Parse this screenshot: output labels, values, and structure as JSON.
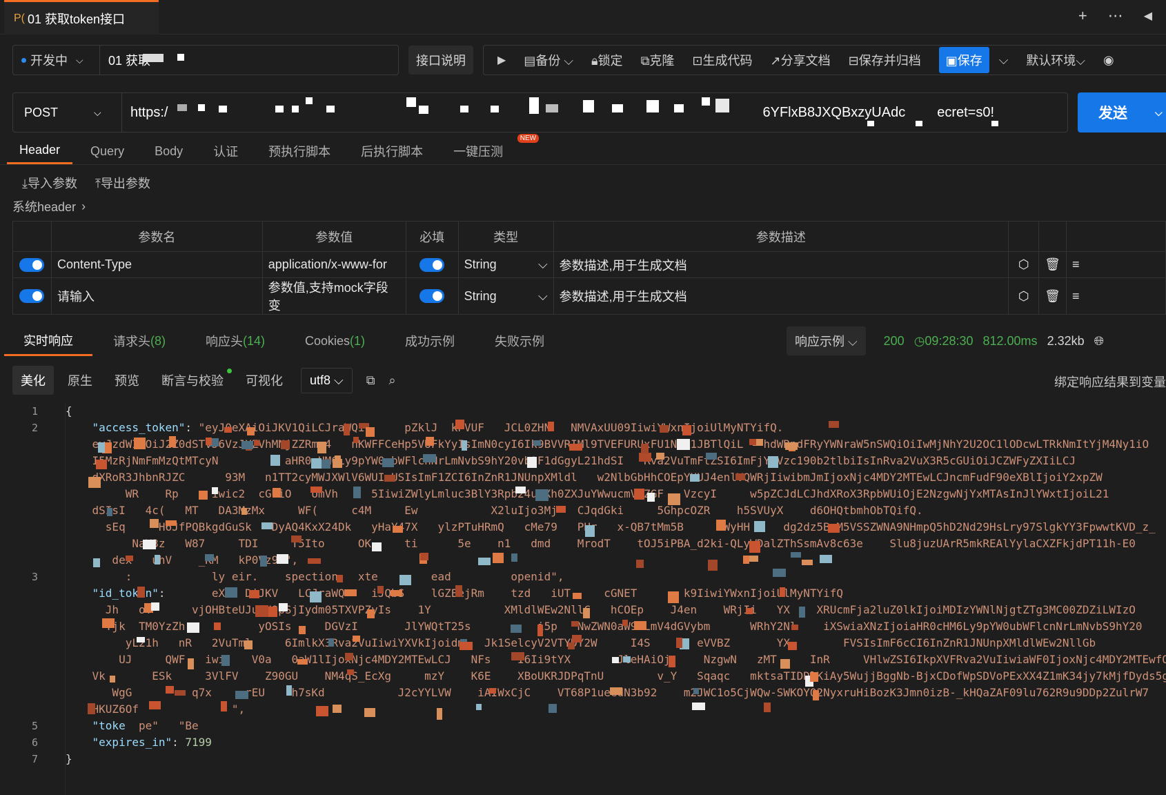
{
  "tab": {
    "method": "P(",
    "title": "01 获取token接口"
  },
  "env": {
    "label": "开发中"
  },
  "request_name": "01 获取",
  "toolbar": {
    "doc": "接口说明",
    "backup": "备份",
    "lock": "锁定",
    "clone": "克隆",
    "gen_code": "生成代码",
    "share_doc": "分享文档",
    "save_archive": "保存并归档",
    "save": "保存",
    "default_env": "默认环境"
  },
  "url": {
    "method": "POST",
    "prefix": "https:/",
    "middle": "6YFlxB8JXQBxzyUAdc",
    "suffix": "ecret=s0!",
    "send": "发送"
  },
  "subtabs": [
    "Header",
    "Query",
    "Body",
    "认证",
    "预执行脚本",
    "后执行脚本",
    "一键压测"
  ],
  "new_badge": "NEW",
  "import_params": "导入参数",
  "export_params": "导出参数",
  "system_header": "系统header",
  "table": {
    "headers": [
      "参数名",
      "参数值",
      "必填",
      "类型",
      "参数描述"
    ],
    "rows": [
      {
        "name": "Content-Type",
        "value": "application/x-www-for",
        "type": "String",
        "desc_placeholder": "参数描述,用于生成文档"
      },
      {
        "name_placeholder": "请输入",
        "value_placeholder": "参数值,支持mock字段变",
        "type": "String",
        "desc_placeholder": "参数描述,用于生成文档"
      }
    ]
  },
  "response_tabs": {
    "realtime": "实时响应",
    "req_headers": "请求头",
    "req_headers_count": "(8)",
    "resp_headers": "响应头",
    "resp_headers_count": "(14)",
    "cookies": "Cookies",
    "cookies_count": "(1)",
    "success_example": "成功示例",
    "fail_example": "失败示例"
  },
  "response_status": {
    "example_select": "响应示例",
    "code": "200",
    "time": "09:28:30",
    "duration": "812.00ms",
    "size": "2.32kb"
  },
  "view_modes": [
    "美化",
    "原生",
    "预览",
    "断言与校验",
    "可视化"
  ],
  "encoding": "utf8",
  "bind_var": "绑定响应结果到变量",
  "colors": {
    "accent": "#f26d21",
    "primary": "#1677e8",
    "success": "#4caf50"
  },
  "code_lines": {
    "l1": "{",
    "l2_key": "\"access_token\"",
    "l2_val": "\"eyJ0eXAiOiJKV1QiLCJraWQi      pZklJ  kPVUF   JCL0ZHN   NMVAxUU09IiwiYWxnIjoiUlMyNTYifQ.",
    "l2b": "eyJzdWIiOiJ2Z0dSTVJ6VzJXZVhMNjZZRmx4   nKWFFCeHp5VUFkYyIsImN0cyI6Ik9BVVRIMl9TVEFURUxFU1NfR1JBTlQiL   hdWRpdFRyYWNraW5nSWQiOiIwMjNhY2U2OC1lODcwLTRkNmItYjM4Ny1iO",
    "l2c": "I5MzRjNmFmMzQtMTcyN          aHR0cHM6Ly9pYW0ubWFlcnNrLmNvbS9hY20vb2F1dGgyL21hdSI   Rva2VuTmFtZSI6ImFjY2Vzc190b2tlbiIsInRva2VuX3R5cGUiOiJCZWFyZXIiLCJ",
    "l2d": "dXRoR3JhbnRJZC      93M   n1TT2cyMWJXWlV6WUIxUSIsImF1ZCI6InZnR1JNUnpXMldl   w2NlbGbHhCOEpYUUJ4enlVQWRjIiwibmJmIjoxNjc4MDY2MTEwLCJncmFudF90eXBlIjoiY2xpZW",
    "l2e": "     WR    Rp     iwic2  cGUiO   UmVh     5IiwiZWlyLmluc3BlY3Rpb24uZXh0ZXJuYWwucmVhZGF   VzcyI     w5pZCJdLCJhdXRoX3RpbWUiOjE2NzgwNjYxMTAsInJlYWxtIjoiL21",
    "l2f": "dSIsI   4c(   MT   DA3MzMx     WF(     c4M     Ew           X2luIjo3Mj   CJqdGki     5GhpcOZR    h5SVUyX    d6OHQtbmhObTQifQ.",
    "l2g": "  sEq     H6JfPQBkgdGuSk   DyAQ4KxX24Dk   yHaY47X   ylzPTuHRmQ   cMe79   PHr   x-QB7tMm5B     OWyHH     dg2dz5BwM5VSSZWNA9NHmpQ5hD2Nd29HsLry97SlgkYY3FpwwtKVD_z_",
    "l2h": "      NaV3z   W87     TDI     T5Ito     OK     ti      5e    n1   dmd    MrodT    tOJ5iPBA_d2ki-QLyWDalZThSsmAv8c63e    Slu8juzUArR5mkREAlYylaCXZFkjdPT11h-E0",
    "l2i": "   dex   uhV    _KM   kP0Vz9A\",",
    "l3": "     :            ly eir.    spection   xte        ead         openid\",",
    "l4_key": "\"id_token\"",
    "l4_val": "      eX   DiJKV   LCJraWQ    iJQbS    lGZEejRm    tzd   iUT     cGNET       k9IiwiYWxnIjoiUlMyNTYifQ",
    "l4b": "  Jh   oY      vjOHBteUJuLU9pSjIydm05TXVPZyIs    1Y           XMldlWEw2NllC   hCOEp    J4en    WRjIi   YX    XRUcmFja2luZ0lkIjoiMDIzYWNlNjgtZTg3MC00ZDZiLWIzO",
    "l4c": "  Yjk  TM0YzZh           yOSIs     DGVzI       JlYWQtT25s          i5p   NwZWN0aW9uLmV4dGVybm      WRhY2Nl    iXSwiaXNzIjoiaHR0cHM6Ly9pYW0ubWFlcnNrLmNvbS9hY20",
    "l4d": "     yL21h   nR   2VuTml     6ImlkX3Rva2VuIiwiYXVkIjoidm   Jk1SelcyV2VTYDY2W     I4S       eVVBZ       YX        FVSIsImF6cCI6InZnR1JNUnpXMldlWEw2NllGb",
    "l4e": "    UJ     QWF   iwi    V0a   0aW1lIjoxNjc4MDY2MTEwLCJ   NFs    I6Ii9tYX       JleHAiOj     NzgwN   zMT     InR     VHlwZSI6IkpXVFRva2VuIiwiaWF0IjoxNjc4MDY2MTEwfQ.",
    "l4f": "Vk       ESk     3VlFV    Z90GU    NM4qS_EcXg     mzY    K6E    XBoUKRJDPqTnU        v_Y   Sqaqc   mktsaTIDDlKiAy5WujjBggNb-BjxCDofWpSDVoPExXX4Z1mK34jy7kMjfDyds5g",
    "l4g": "   WgG         q7x     rEU    h7sKd           J2cYYLVW    iAIWxCjC    VT68P1ueedN3b92    m2JWC1o5CjWQw-SWKOYO2NyxruHiBozK3Jmn0izB-_kHQaZAF09lu762R9u9DDp2ZulrW7",
    "l4h": "HKUZ6Of              \",",
    "l5_key": "\"toke",
    "l5_rest": "  pe\"   \"Be",
    "l6_key": "\"expires_in\"",
    "l6_val": "7199",
    "l7": "}"
  }
}
